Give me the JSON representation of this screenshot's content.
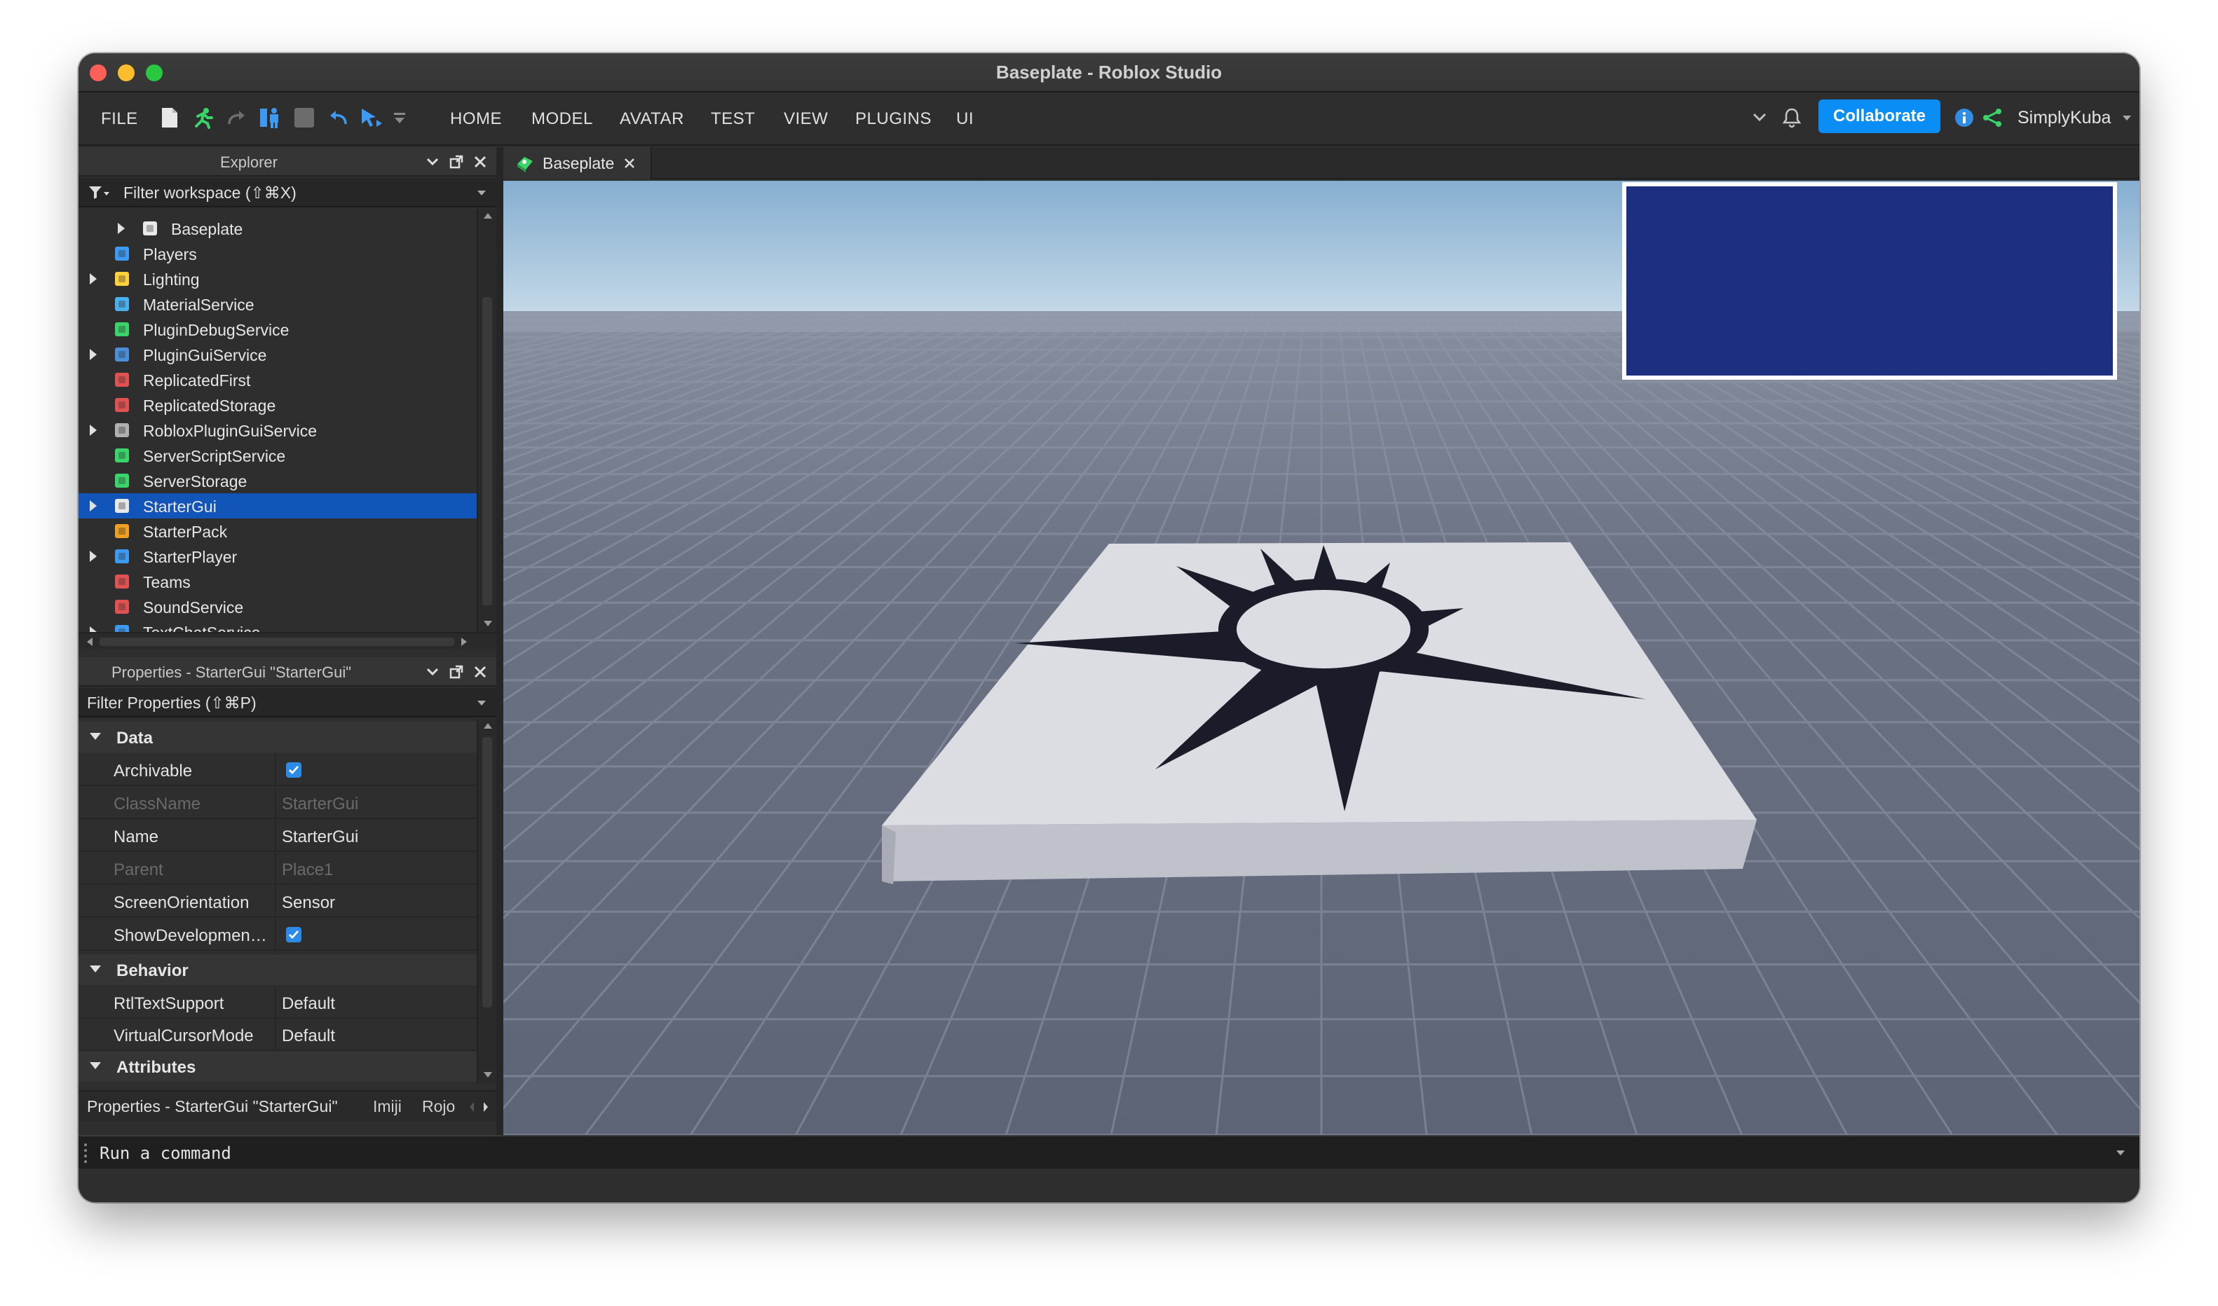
{
  "window": {
    "title": "Baseplate - Roblox Studio"
  },
  "menubar": {
    "file": "FILE",
    "tabs": [
      "HOME",
      "MODEL",
      "AVATAR",
      "TEST",
      "VIEW",
      "PLUGINS",
      "UI"
    ],
    "collaborate": "Collaborate",
    "username": "SimplyKuba"
  },
  "explorer": {
    "title": "Explorer",
    "filter_placeholder": "Filter workspace (⇧⌘X)",
    "items": [
      {
        "label": "Baseplate",
        "icon": "part-icon",
        "expandable": true
      },
      {
        "label": "Players",
        "icon": "players-icon",
        "expandable": false
      },
      {
        "label": "Lighting",
        "icon": "lighting-icon",
        "expandable": true
      },
      {
        "label": "MaterialService",
        "icon": "material-service-icon",
        "expandable": false
      },
      {
        "label": "PluginDebugService",
        "icon": "plugin-debug-icon",
        "expandable": false
      },
      {
        "label": "PluginGuiService",
        "icon": "plugin-gui-icon",
        "expandable": true
      },
      {
        "label": "ReplicatedFirst",
        "icon": "replicated-first-icon",
        "expandable": false
      },
      {
        "label": "ReplicatedStorage",
        "icon": "replicated-storage-icon",
        "expandable": false
      },
      {
        "label": "RobloxPluginGuiService",
        "icon": "roblox-plugin-gui-icon",
        "expandable": true
      },
      {
        "label": "ServerScriptService",
        "icon": "server-script-icon",
        "expandable": false
      },
      {
        "label": "ServerStorage",
        "icon": "server-storage-icon",
        "expandable": false
      },
      {
        "label": "StarterGui",
        "icon": "starter-gui-icon",
        "expandable": true,
        "selected": true
      },
      {
        "label": "StarterPack",
        "icon": "starter-pack-icon",
        "expandable": false
      },
      {
        "label": "StarterPlayer",
        "icon": "starter-player-icon",
        "expandable": true
      },
      {
        "label": "Teams",
        "icon": "teams-icon",
        "expandable": false
      },
      {
        "label": "SoundService",
        "icon": "sound-icon",
        "expandable": false
      },
      {
        "label": "TextChatService",
        "icon": "text-chat-icon",
        "expandable": true
      }
    ]
  },
  "properties": {
    "title": "Properties - StarterGui \"StarterGui\"",
    "filter_placeholder": "Filter Properties (⇧⌘P)",
    "categories": {
      "data": "Data",
      "behavior": "Behavior",
      "attributes": "Attributes"
    },
    "data_rows": [
      {
        "name": "Archivable",
        "value": "",
        "checkbox": true,
        "dim": false
      },
      {
        "name": "ClassName",
        "value": "StarterGui",
        "checkbox": false,
        "dim": true
      },
      {
        "name": "Name",
        "value": "StarterGui",
        "checkbox": false,
        "dim": false
      },
      {
        "name": "Parent",
        "value": "Place1",
        "checkbox": false,
        "dim": true
      },
      {
        "name": "ScreenOrientation",
        "value": "Sensor",
        "checkbox": false,
        "dim": false
      },
      {
        "name": "ShowDevelopmen…",
        "value": "",
        "checkbox": true,
        "dim": false
      }
    ],
    "behavior_rows": [
      {
        "name": "RtlTextSupport",
        "value": "Default"
      },
      {
        "name": "VirtualCursorMode",
        "value": "Default"
      }
    ]
  },
  "bottom_tabs": [
    "Properties - StarterGui \"StarterGui\"",
    "Imiji",
    "Rojo"
  ],
  "document": {
    "tab_label": "Baseplate"
  },
  "command_bar": {
    "placeholder": "Run a command"
  },
  "colors": {
    "accent": "#0a8ef5",
    "selection": "#1055b7",
    "gui_frame": "#1d2f80"
  }
}
